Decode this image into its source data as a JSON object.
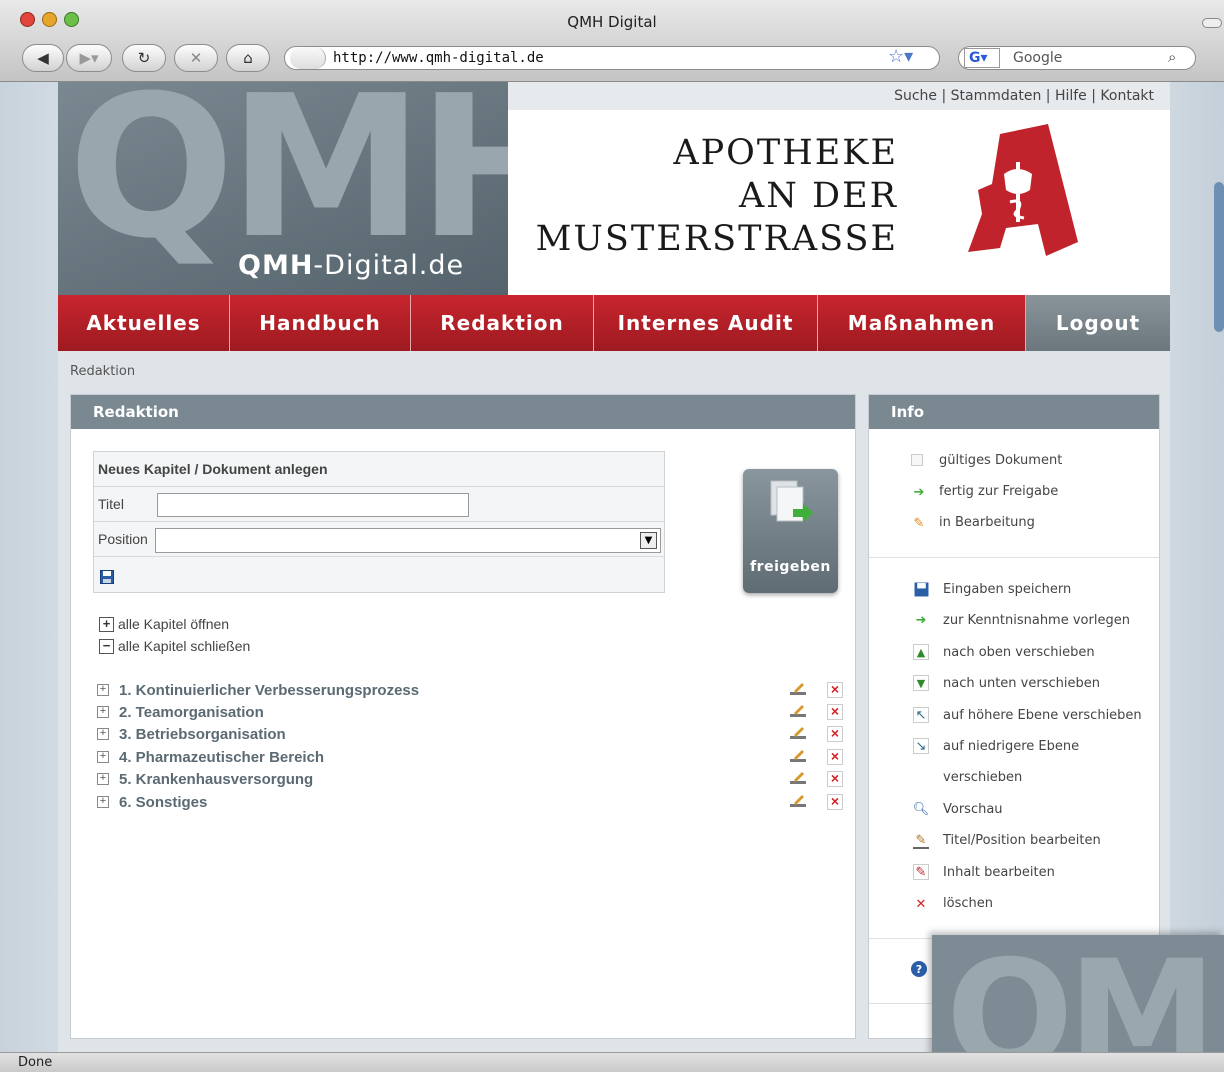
{
  "window": {
    "title": "QMH Digital"
  },
  "toolbar": {
    "url": "http://www.qmh-digital.de",
    "search_placeholder": "Google"
  },
  "header": {
    "logo_big": "QMH",
    "logo_text_bold": "QMH",
    "logo_text_rest": "-Digital.de",
    "top_links": "Suche | Stammdaten | Hilfe | Kontakt",
    "pharmacy_line1": "APOTHEKE",
    "pharmacy_line2": "AN DER",
    "pharmacy_line3": "MUSTERSTRASSE"
  },
  "nav": {
    "items": [
      {
        "label": "Aktuelles"
      },
      {
        "label": "Handbuch"
      },
      {
        "label": "Redaktion"
      },
      {
        "label": "Internes Audit"
      },
      {
        "label": "Maßnahmen"
      },
      {
        "label": "Logout"
      }
    ]
  },
  "breadcrumb": "Redaktion",
  "main": {
    "title": "Redaktion",
    "form": {
      "heading": "Neues Kapitel / Dokument anlegen",
      "title_label": "Titel",
      "title_value": "",
      "position_label": "Position",
      "position_value": ""
    },
    "release_button": "freigeben",
    "open_all": "alle Kapitel öffnen",
    "close_all": "alle Kapitel schließen",
    "chapters": [
      "1. Kontinuierlicher Verbesserungsprozess",
      "2. Teamorganisation",
      "3. Betriebsorganisation",
      "4. Pharmazeutischer Bereich",
      "5. Krankenhausversorgung",
      "6. Sonstiges"
    ]
  },
  "info": {
    "title": "Info",
    "status_legend": [
      "gültiges Dokument",
      "fertig zur Freigabe",
      "in Bearbeitung"
    ],
    "action_legend": [
      "Eingaben speichern",
      "zur Kenntnisnahme vorlegen",
      "nach oben verschieben",
      "nach unten verschieben",
      "auf höhere Ebene verschieben",
      "auf niedrigere Ebene",
      "verschieben",
      "Vorschau",
      "Titel/Position bearbeiten",
      "Inhalt bearbeiten",
      "löschen"
    ]
  },
  "overlay": {
    "text": "QM"
  },
  "status_bar": "Done",
  "colors": {
    "brand_red": "#c0232b",
    "panel_gray": "#7a8891"
  }
}
